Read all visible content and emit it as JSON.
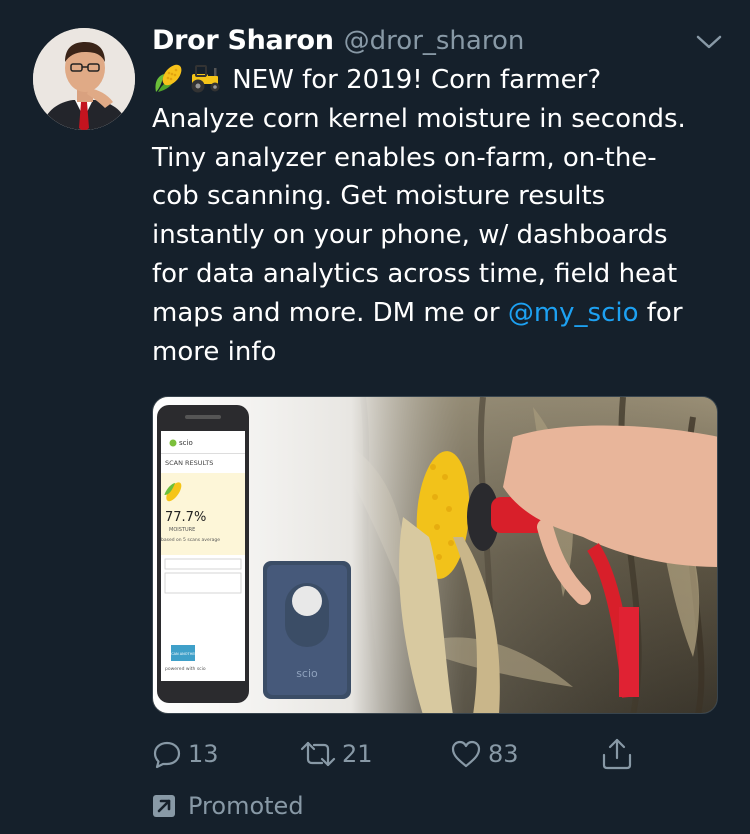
{
  "tweet": {
    "display_name": "Dror Sharon",
    "handle": "@dror_sharon",
    "text_lines": [
      " NEW for 2019! Corn farmer?",
      "Analyze corn kernel moisture in seconds.",
      "Tiny analyzer enables on-farm, on-the-",
      "cob scanning. Get moisture results",
      "instantly on your phone, w/ dashboards",
      "for data analytics across time, field heat",
      "maps and more. DM me or "
    ],
    "mention": "@my_scio",
    "after_mention": " for",
    "last_line": "more info",
    "emojis": [
      "corn-emoji",
      "tractor-emoji"
    ],
    "media": {
      "phone_app": "scio",
      "phone_header": "SCAN RESULTS",
      "moisture_value": "77.7%",
      "moisture_label": "MOISTURE",
      "average_note": "based on 5 scans average",
      "scan_button": "SCAN ANOTHER",
      "powered_by": "powered with scio",
      "device_brand": "scio"
    },
    "actions": {
      "reply_count": "13",
      "retweet_count": "21",
      "like_count": "83"
    },
    "promoted_label": "Promoted"
  },
  "colors": {
    "background": "#15202b",
    "secondary_text": "#8899a6",
    "link": "#1da1f2"
  },
  "icons": [
    "chevron-down-icon",
    "reply-icon",
    "retweet-icon",
    "like-icon",
    "share-icon",
    "promoted-icon"
  ]
}
